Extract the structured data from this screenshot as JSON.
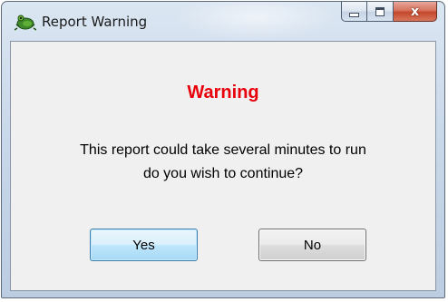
{
  "window": {
    "title": "Report Warning",
    "app_icon": "tree-frog-icon",
    "close_glyph": "x",
    "caption_icons": [
      "minimize-icon",
      "maximize-icon",
      "close-icon"
    ]
  },
  "dialog": {
    "heading": "Warning",
    "message_line1": "This report could take several minutes to run",
    "message_line2": "do you wish to continue?"
  },
  "buttons": {
    "yes_label": "Yes",
    "no_label": "No"
  },
  "colors": {
    "heading": "#e8000b",
    "client_bg": "#f0f0f0",
    "frame": "#c9d8ea",
    "close_button": "#c4472c",
    "default_button_border": "#3c7fb1"
  }
}
